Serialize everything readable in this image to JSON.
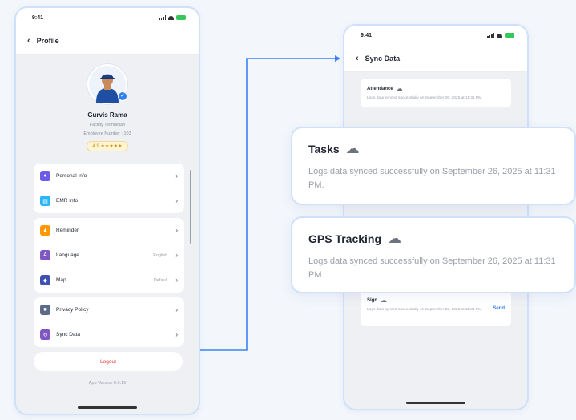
{
  "profile_screen": {
    "time": "9:41",
    "title": "Profile",
    "user": {
      "name": "Gurvis Rama",
      "role": "Facility Technician",
      "location": "Employee Number : 103",
      "rating": "4.9 ★★★★★"
    },
    "menu_groups": [
      [
        {
          "label": "Personal Info",
          "value": "",
          "icon": "user-icon",
          "color": "#6c5ce7"
        },
        {
          "label": "EMR Info",
          "value": "",
          "icon": "document-icon",
          "color": "#29b6f6"
        }
      ],
      [
        {
          "label": "Reminder",
          "value": "",
          "icon": "bell-icon",
          "color": "#ff9800"
        },
        {
          "label": "Language",
          "value": "English",
          "icon": "language-icon",
          "color": "#7e57c2"
        },
        {
          "label": "Map",
          "value": "Default",
          "icon": "map-icon",
          "color": "#3f51b5"
        }
      ],
      [
        {
          "label": "Privacy Policy",
          "value": "",
          "icon": "shield-icon",
          "color": "#5c6b8a"
        },
        {
          "label": "Sync Data",
          "value": "",
          "icon": "sync-icon",
          "color": "#7e57c2"
        }
      ]
    ],
    "logout_label": "Logout",
    "version": "App Version 0.0.19"
  },
  "sync_screen": {
    "time": "9:41",
    "title": "Sync Data",
    "top_card": {
      "title": "Attendance",
      "text": "Logs data synced successfully on September 26, 2025 at 11:31 PM."
    },
    "bottom_card": {
      "title": "Sign",
      "text": "Logs data synced successfully on September 26, 2025 at 11:31 PM.",
      "action": "Send"
    }
  },
  "highlight_cards": [
    {
      "title": "Tasks",
      "text": "Logs data synced successfully on September 26, 2025 at 11:31 PM."
    },
    {
      "title": "GPS Tracking",
      "text": "Logs data synced successfully on September 26, 2025 at 11:31 PM."
    }
  ],
  "colors": {
    "accent": "#2f80ed",
    "frame_border": "#cfe0fb",
    "logout": "#e53935",
    "rating_bg": "#fff4d6"
  }
}
